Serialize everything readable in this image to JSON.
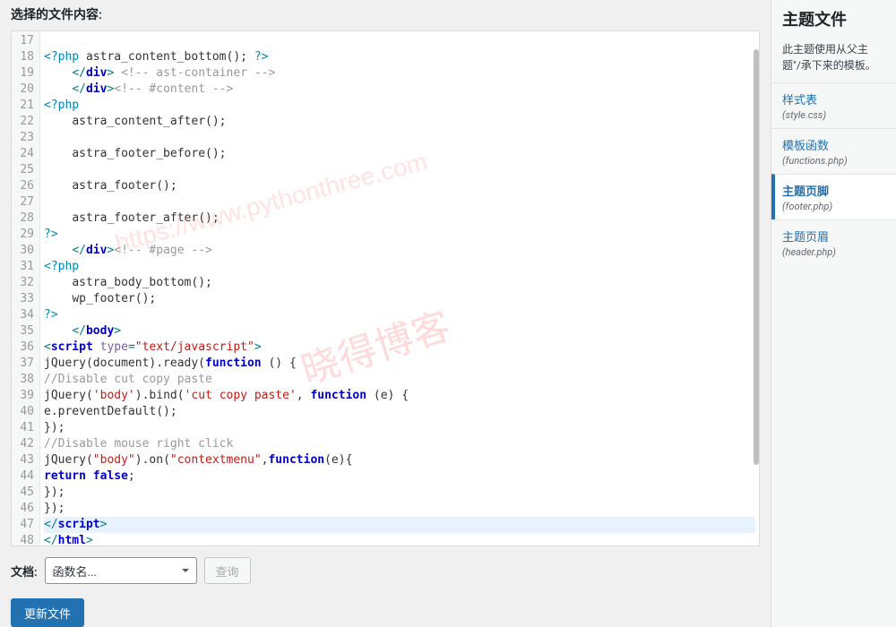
{
  "header": {
    "label": "选择的文件内容:"
  },
  "editor": {
    "startLine": 17,
    "highlightLine": 47,
    "lines": [
      {
        "tokens": []
      },
      {
        "tokens": [
          [
            "t-php",
            "<?php "
          ],
          [
            "t-fn",
            "astra_content_bottom(); "
          ],
          [
            "t-php",
            "?>"
          ]
        ]
      },
      {
        "tokens": [
          [
            "",
            "    "
          ],
          [
            "t-tag",
            "</"
          ],
          [
            "t-kw",
            "div"
          ],
          [
            "t-tag",
            "> "
          ],
          [
            "t-cm",
            "<!-- ast-container -->"
          ]
        ]
      },
      {
        "tokens": [
          [
            "",
            "    "
          ],
          [
            "t-tag",
            "</"
          ],
          [
            "t-kw",
            "div"
          ],
          [
            "t-tag",
            ">"
          ],
          [
            "t-cm",
            "<!-- #content -->"
          ]
        ]
      },
      {
        "tokens": [
          [
            "t-php",
            "<?php"
          ]
        ]
      },
      {
        "tokens": [
          [
            "",
            "    "
          ],
          [
            "t-fn",
            "astra_content_after();"
          ]
        ]
      },
      {
        "tokens": []
      },
      {
        "tokens": [
          [
            "",
            "    "
          ],
          [
            "t-fn",
            "astra_footer_before();"
          ]
        ]
      },
      {
        "tokens": []
      },
      {
        "tokens": [
          [
            "",
            "    "
          ],
          [
            "t-fn",
            "astra_footer();"
          ]
        ]
      },
      {
        "tokens": []
      },
      {
        "tokens": [
          [
            "",
            "    "
          ],
          [
            "t-fn",
            "astra_footer_after();"
          ]
        ]
      },
      {
        "tokens": [
          [
            "t-php",
            "?>"
          ]
        ]
      },
      {
        "tokens": [
          [
            "",
            "    "
          ],
          [
            "t-tag",
            "</"
          ],
          [
            "t-kw",
            "div"
          ],
          [
            "t-tag",
            ">"
          ],
          [
            "t-cm",
            "<!-- #page -->"
          ]
        ]
      },
      {
        "tokens": [
          [
            "t-php",
            "<?php"
          ]
        ]
      },
      {
        "tokens": [
          [
            "",
            "    "
          ],
          [
            "t-fn",
            "astra_body_bottom();"
          ]
        ]
      },
      {
        "tokens": [
          [
            "",
            "    "
          ],
          [
            "t-fn",
            "wp_footer();"
          ]
        ]
      },
      {
        "tokens": [
          [
            "t-php",
            "?>"
          ]
        ]
      },
      {
        "tokens": [
          [
            "",
            "    "
          ],
          [
            "t-tag",
            "</"
          ],
          [
            "t-kw",
            "body"
          ],
          [
            "t-tag",
            ">"
          ]
        ]
      },
      {
        "tokens": [
          [
            "t-tag",
            "<"
          ],
          [
            "t-kw",
            "script "
          ],
          [
            "t-attr",
            "type"
          ],
          [
            "t-tag",
            "="
          ],
          [
            "t-str",
            "\"text/javascript\""
          ],
          [
            "t-tag",
            ">"
          ]
        ]
      },
      {
        "tokens": [
          [
            "t-fn",
            "jQuery(document).ready("
          ],
          [
            "t-kw",
            "function"
          ],
          [
            "t-fn",
            " () {"
          ]
        ]
      },
      {
        "tokens": [
          [
            "t-cm",
            "//Disable cut copy paste"
          ]
        ]
      },
      {
        "tokens": [
          [
            "t-fn",
            "jQuery("
          ],
          [
            "t-str",
            "'body'"
          ],
          [
            "t-fn",
            ").bind("
          ],
          [
            "t-str",
            "'cut copy paste'"
          ],
          [
            "t-fn",
            ", "
          ],
          [
            "t-kw",
            "function"
          ],
          [
            "t-fn",
            " (e) {"
          ]
        ]
      },
      {
        "tokens": [
          [
            "t-fn",
            "e.preventDefault();"
          ]
        ]
      },
      {
        "tokens": [
          [
            "t-fn",
            "});"
          ]
        ]
      },
      {
        "tokens": [
          [
            "t-cm",
            "//Disable mouse right click"
          ]
        ]
      },
      {
        "tokens": [
          [
            "t-fn",
            "jQuery("
          ],
          [
            "t-str",
            "\"body\""
          ],
          [
            "t-fn",
            ").on("
          ],
          [
            "t-str",
            "\"contextmenu\""
          ],
          [
            "t-fn",
            ","
          ],
          [
            "t-kw",
            "function"
          ],
          [
            "t-fn",
            "(e){"
          ]
        ]
      },
      {
        "tokens": [
          [
            "t-kw",
            "return false"
          ],
          [
            "t-fn",
            ";"
          ]
        ]
      },
      {
        "tokens": [
          [
            "t-fn",
            "});"
          ]
        ]
      },
      {
        "tokens": [
          [
            "t-fn",
            "});"
          ]
        ]
      },
      {
        "tokens": [
          [
            "t-tag",
            "</"
          ],
          [
            "t-kw",
            "script"
          ],
          [
            "t-tag",
            ">"
          ]
        ]
      },
      {
        "tokens": [
          [
            "t-tag",
            "</"
          ],
          [
            "t-kw",
            "html"
          ],
          [
            "t-tag",
            ">"
          ]
        ]
      },
      {
        "tokens": []
      }
    ]
  },
  "bottom": {
    "docsLabel": "文档:",
    "selectPlaceholder": "函数名...",
    "lookupBtn": "查询",
    "updateBtn": "更新文件"
  },
  "sidebar": {
    "title": "主题文件",
    "desc": "此主题使用从父主题\"/承下来的模板。",
    "files": [
      {
        "name": "样式表",
        "path": "(style.css)",
        "active": false
      },
      {
        "name": "模板函数",
        "path": "(functions.php)",
        "active": false
      },
      {
        "name": "主题页脚",
        "path": "(footer.php)",
        "active": true
      },
      {
        "name": "主题页眉",
        "path": "(header.php)",
        "active": false
      }
    ]
  },
  "watermark": {
    "text1": "晓得博客",
    "text2": "https://www.pythonthree.com"
  }
}
